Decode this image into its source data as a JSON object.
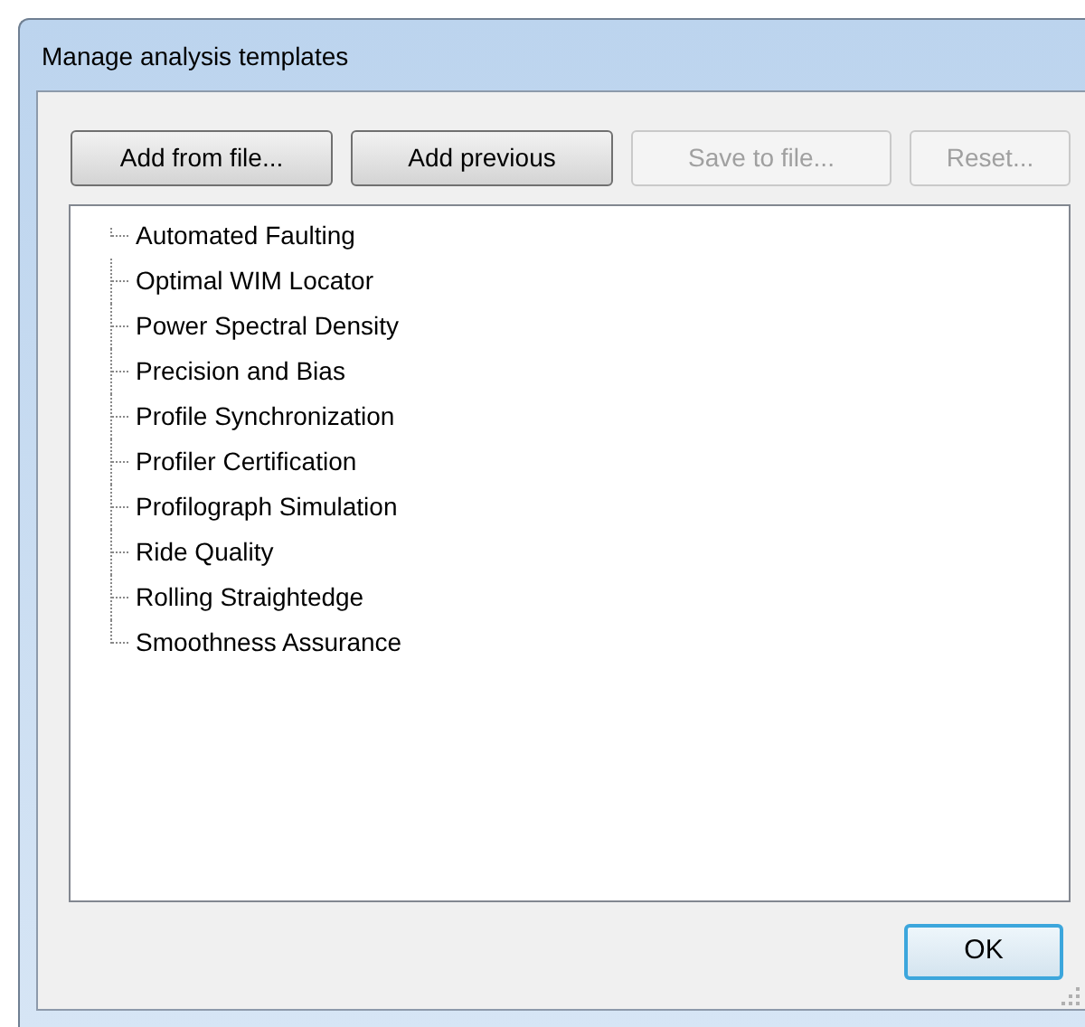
{
  "window": {
    "title": "Manage analysis templates"
  },
  "buttons": [
    {
      "label": "Add from file...",
      "disabled": false
    },
    {
      "label": "Add previous",
      "disabled": false
    },
    {
      "label": "Save to file...",
      "disabled": true
    },
    {
      "label": "Reset...",
      "disabled": true
    }
  ],
  "tree": {
    "items": [
      {
        "label": "Automated Faulting"
      },
      {
        "label": "Optimal WIM Locator"
      },
      {
        "label": "Power Spectral Density"
      },
      {
        "label": "Precision and Bias"
      },
      {
        "label": "Profile Synchronization"
      },
      {
        "label": "Profiler Certification"
      },
      {
        "label": "Profilograph Simulation"
      },
      {
        "label": "Ride Quality"
      },
      {
        "label": "Rolling Straightedge"
      },
      {
        "label": "Smoothness Assurance"
      }
    ]
  },
  "ok_button": {
    "label": "OK",
    "focused": true
  }
}
